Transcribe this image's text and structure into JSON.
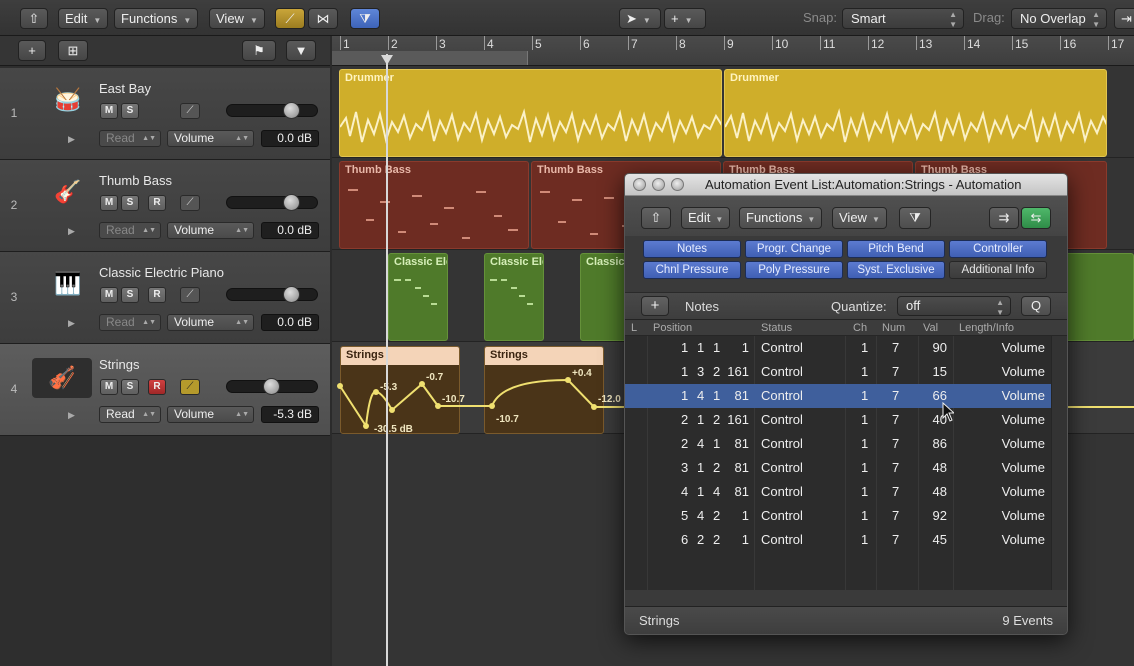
{
  "toolbar": {
    "edit": "Edit",
    "functions": "Functions",
    "view": "View",
    "snap_label": "Snap:",
    "snap_value": "Smart",
    "drag_label": "Drag:",
    "drag_value": "No Overlap"
  },
  "ruler": {
    "bars": [
      "1",
      "2",
      "3",
      "4",
      "5",
      "6",
      "7",
      "8",
      "9",
      "10",
      "11",
      "12",
      "13",
      "14",
      "15",
      "16",
      "17"
    ]
  },
  "tracks": [
    {
      "num": "1",
      "name": "East Bay",
      "mute": "M",
      "solo": "S",
      "mode": "Read",
      "param": "Volume",
      "value": "0.0 dB"
    },
    {
      "num": "2",
      "name": "Thumb Bass",
      "mute": "M",
      "solo": "S",
      "rec": "R",
      "mode": "Read",
      "param": "Volume",
      "value": "0.0 dB"
    },
    {
      "num": "3",
      "name": "Classic Electric Piano",
      "mute": "M",
      "solo": "S",
      "rec": "R",
      "mode": "Read",
      "param": "Volume",
      "value": "0.0 dB"
    },
    {
      "num": "4",
      "name": "Strings",
      "mute": "M",
      "solo": "S",
      "rec": "R",
      "mode": "Read",
      "param": "Volume",
      "value": "-5.3 dB"
    }
  ],
  "regions": {
    "drummer": "Drummer",
    "thumb_bass": "Thumb Bass",
    "classic_ep": "Classic Ele",
    "strings": "Strings",
    "automation_values": [
      "-5.3",
      "-0.7",
      "-10.7",
      "-30.5 dB",
      "+0.4",
      "-10.7",
      "-12.0"
    ]
  },
  "automation_window": {
    "title": "Automation Event List:Automation:Strings - Automation",
    "edit": "Edit",
    "functions": "Functions",
    "view": "View",
    "filters": [
      {
        "label": "Notes",
        "active": true
      },
      {
        "label": "Progr. Change",
        "active": true
      },
      {
        "label": "Pitch Bend",
        "active": true
      },
      {
        "label": "Controller",
        "active": true
      },
      {
        "label": "Chnl Pressure",
        "active": true
      },
      {
        "label": "Poly Pressure",
        "active": true
      },
      {
        "label": "Syst. Exclusive",
        "active": true
      },
      {
        "label": "Additional Info",
        "active": false
      }
    ],
    "add_label": "+",
    "notes_label": "Notes",
    "quantize_label": "Quantize:",
    "quantize_value": "off",
    "q_button": "Q",
    "columns": [
      "L",
      "Position",
      "Status",
      "Ch",
      "Num",
      "Val",
      "Length/Info"
    ],
    "events": [
      {
        "bar": "1",
        "beat": "1",
        "div": "1",
        "tick": "1",
        "status": "Control",
        "ch": "1",
        "num": "7",
        "val": "90",
        "info": "Volume"
      },
      {
        "bar": "1",
        "beat": "3",
        "div": "2",
        "tick": "161",
        "status": "Control",
        "ch": "1",
        "num": "7",
        "val": "15",
        "info": "Volume"
      },
      {
        "bar": "1",
        "beat": "4",
        "div": "1",
        "tick": "81",
        "status": "Control",
        "ch": "1",
        "num": "7",
        "val": "66",
        "info": "Volume"
      },
      {
        "bar": "2",
        "beat": "1",
        "div": "2",
        "tick": "161",
        "status": "Control",
        "ch": "1",
        "num": "7",
        "val": "40",
        "info": "Volume"
      },
      {
        "bar": "2",
        "beat": "4",
        "div": "1",
        "tick": "81",
        "status": "Control",
        "ch": "1",
        "num": "7",
        "val": "86",
        "info": "Volume"
      },
      {
        "bar": "3",
        "beat": "1",
        "div": "2",
        "tick": "81",
        "status": "Control",
        "ch": "1",
        "num": "7",
        "val": "48",
        "info": "Volume"
      },
      {
        "bar": "4",
        "beat": "1",
        "div": "4",
        "tick": "81",
        "status": "Control",
        "ch": "1",
        "num": "7",
        "val": "48",
        "info": "Volume"
      },
      {
        "bar": "5",
        "beat": "4",
        "div": "2",
        "tick": "1",
        "status": "Control",
        "ch": "1",
        "num": "7",
        "val": "92",
        "info": "Volume"
      },
      {
        "bar": "6",
        "beat": "2",
        "div": "2",
        "tick": "1",
        "status": "Control",
        "ch": "1",
        "num": "7",
        "val": "45",
        "info": "Volume"
      }
    ],
    "selected_event": 2,
    "footer_name": "Strings",
    "footer_count": "9 Events"
  },
  "colors": {
    "accent": "#4a6fc8",
    "drummer": "#cfae2a",
    "bass": "#6e2c22",
    "piano": "#4f7a2a",
    "strings": "#f4d4b8"
  }
}
